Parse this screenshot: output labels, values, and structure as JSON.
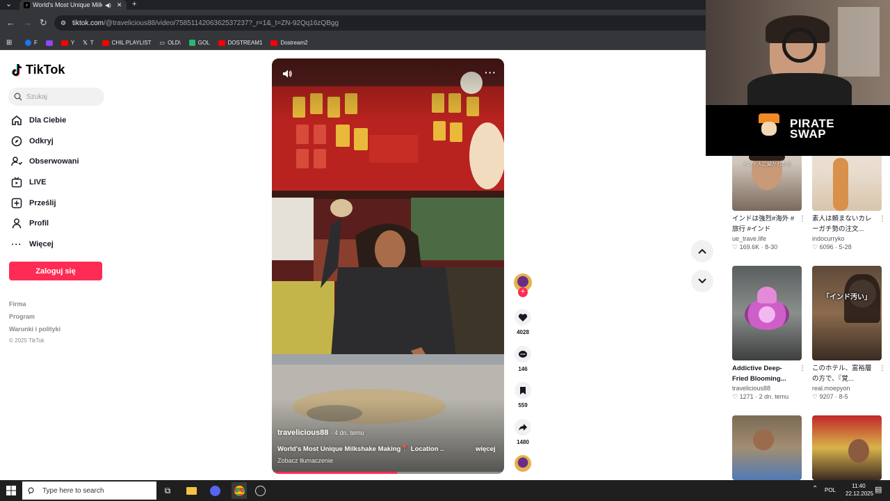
{
  "browser": {
    "tab_title": "World's Most Unique Milkshake",
    "url_domain": "tiktok.com",
    "url_path": "/@travelicious88/video/7585114206362537237?_r=1&_t=ZN-92Qq16zQBgg",
    "bookmarks": [
      "F",
      "",
      "Y",
      "T",
      "CHIL PLAYLIST",
      "OLD\\",
      "GOL",
      "DOSTREAM1",
      "Dostream2"
    ]
  },
  "sidebar": {
    "logo": "TikTok",
    "search_placeholder": "Szukaj",
    "items": [
      {
        "label": "Dla Ciebie",
        "icon": "home-icon"
      },
      {
        "label": "Odkryj",
        "icon": "compass-icon"
      },
      {
        "label": "Obserwowani",
        "icon": "following-icon"
      },
      {
        "label": "LIVE",
        "icon": "live-icon"
      },
      {
        "label": "Prześlij",
        "icon": "upload-icon"
      },
      {
        "label": "Profil",
        "icon": "profile-icon"
      },
      {
        "label": "Więcej",
        "icon": "more-icon"
      }
    ],
    "login": "Zaloguj się",
    "footer": [
      "Firma",
      "Program",
      "Warunki i polityki",
      "© 2025 TikTok"
    ]
  },
  "video": {
    "author": "travelicious88",
    "age": "· 4 dn. temu",
    "caption": "World's Most Unique Milkshake Making📍 Location ...",
    "more": "więcej",
    "translate": "Zobacz tłumaczenie",
    "progress": 0.54
  },
  "actions": {
    "likes": "4028",
    "comments": "146",
    "saves": "559",
    "shares": "1480"
  },
  "webcam": {
    "brand_line1": "PIRATE",
    "brand_line2": "SWAP"
  },
  "recommendations": [
    {
      "caption": "インドは強烈#海外 #旅行 #インド",
      "author": "ue_trave.life",
      "likes": "169.6K",
      "date": "8-30",
      "bold": false,
      "overlay": "インド人に聞かれたら"
    },
    {
      "caption": "素人は頼まないカレーガチ勢の注文...",
      "author": "indocurryko",
      "likes": "6096",
      "date": "5-28",
      "bold": false,
      "overlay": ""
    },
    {
      "caption": "Addictive Deep-Fried Blooming...",
      "author": "travelicious88",
      "likes": "1271",
      "date": "2 dn. temu",
      "bold": true,
      "overlay": ""
    },
    {
      "caption": "このホテル、富裕層の方で、『覚...",
      "author": "real.moepyon",
      "likes": "9207",
      "date": "8-5",
      "bold": false,
      "overlay": "「インド汚い」"
    }
  ],
  "taskbar": {
    "search_placeholder": "Type here to search",
    "lang": "POL",
    "time": "11:40",
    "date": "22.12.2025"
  }
}
